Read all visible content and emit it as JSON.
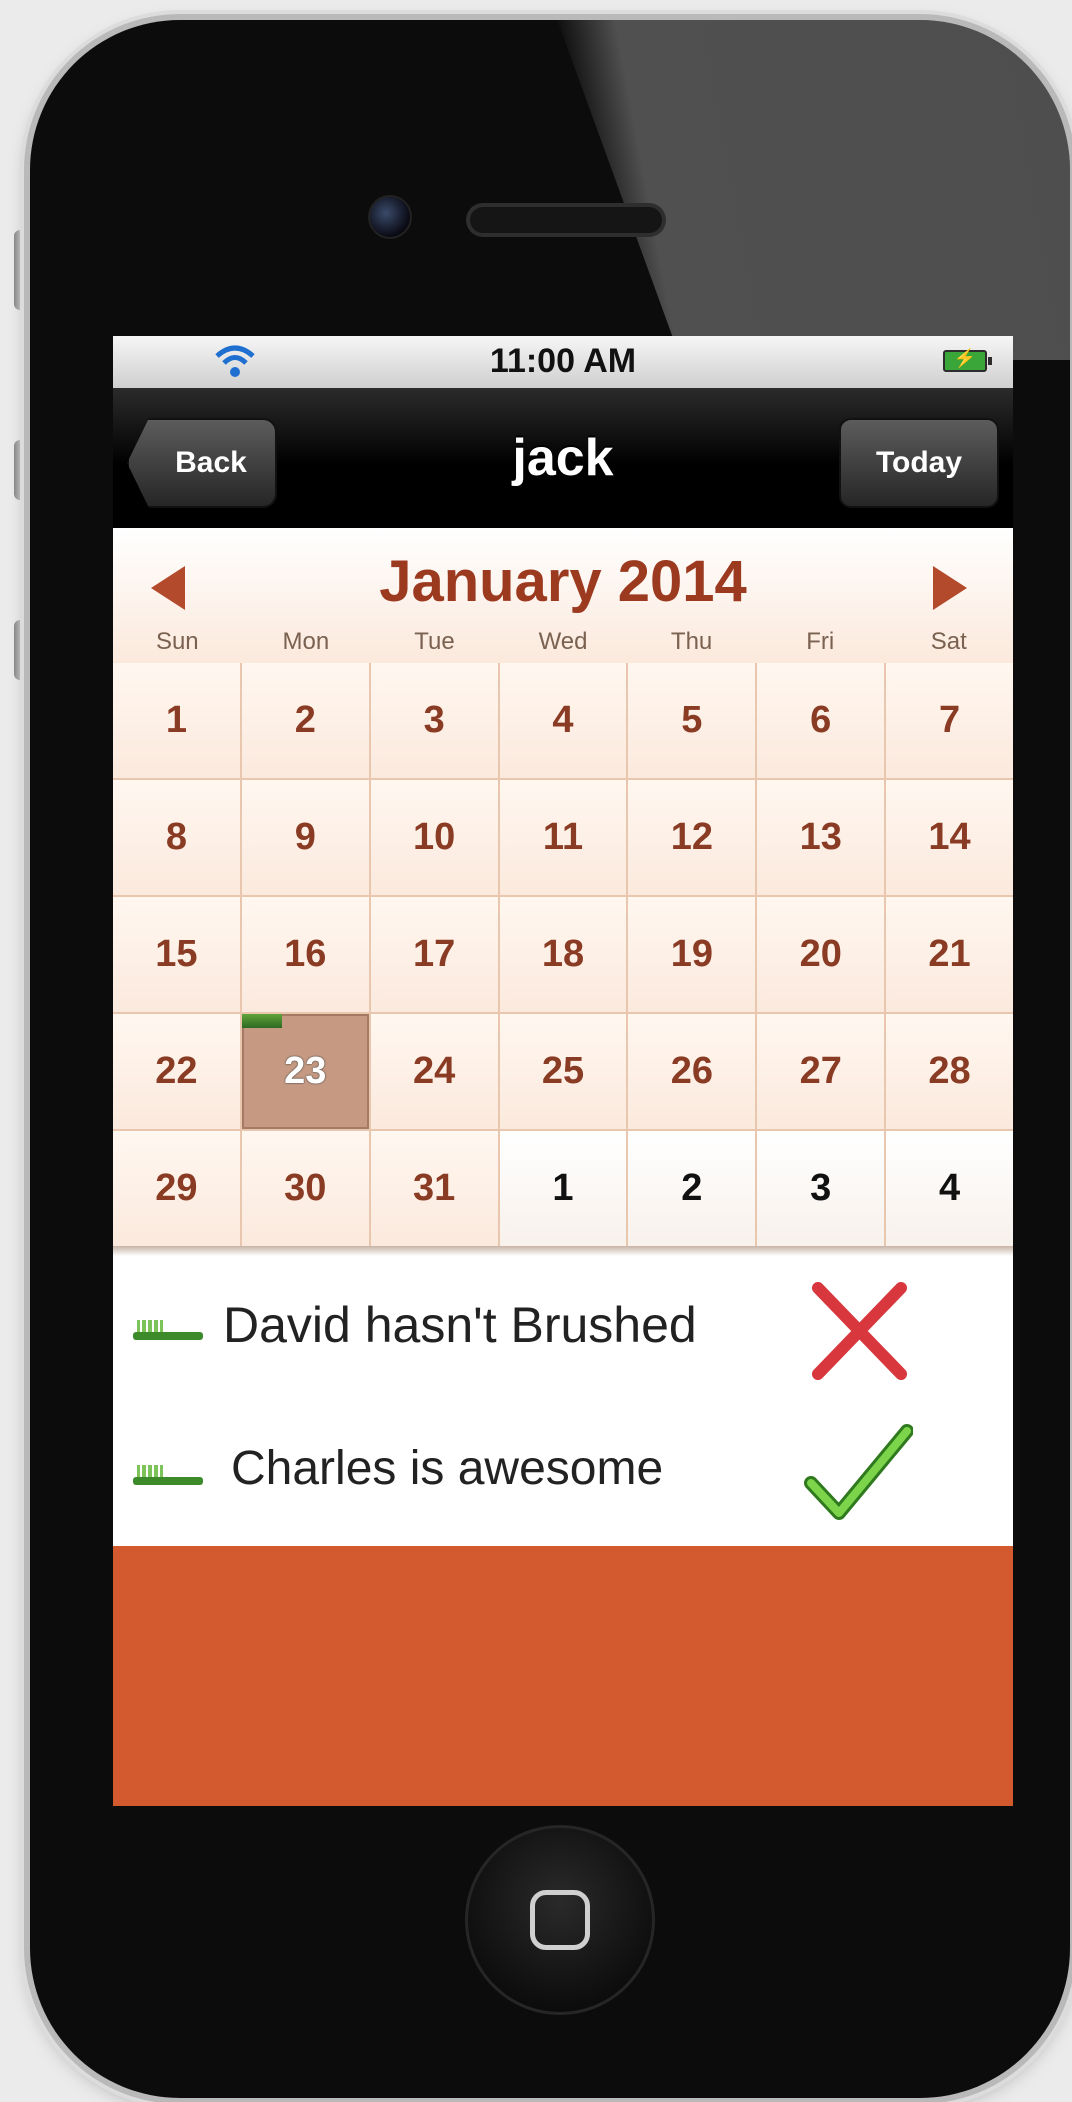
{
  "status_bar": {
    "time": "11:00 AM",
    "wifi_icon": "wifi-icon",
    "battery_icon": "battery-charging-icon"
  },
  "nav": {
    "back_label": "Back",
    "title": "jack",
    "today_label": "Today"
  },
  "calendar": {
    "month_title": "January 2014",
    "weekdays": [
      "Sun",
      "Mon",
      "Tue",
      "Wed",
      "Thu",
      "Fri",
      "Sat"
    ],
    "days": [
      "1",
      "2",
      "3",
      "4",
      "5",
      "6",
      "7",
      "8",
      "9",
      "10",
      "11",
      "12",
      "13",
      "14",
      "15",
      "16",
      "17",
      "18",
      "19",
      "20",
      "21",
      "22",
      "23",
      "24",
      "25",
      "26",
      "27",
      "28",
      "29",
      "30",
      "31",
      "1",
      "2",
      "3",
      "4"
    ],
    "selected_day": "23",
    "accent_color": "#9c3a20"
  },
  "events": [
    {
      "text": "David hasn't Brushed",
      "status": "cross-icon",
      "status_color": "#d7373d"
    },
    {
      "text": "Charles is awesome",
      "status": "checkmark-icon",
      "status_color": "#6bc43a"
    }
  ],
  "colors": {
    "footer": "#d35a2f",
    "selected_cell": "#c69a82"
  }
}
